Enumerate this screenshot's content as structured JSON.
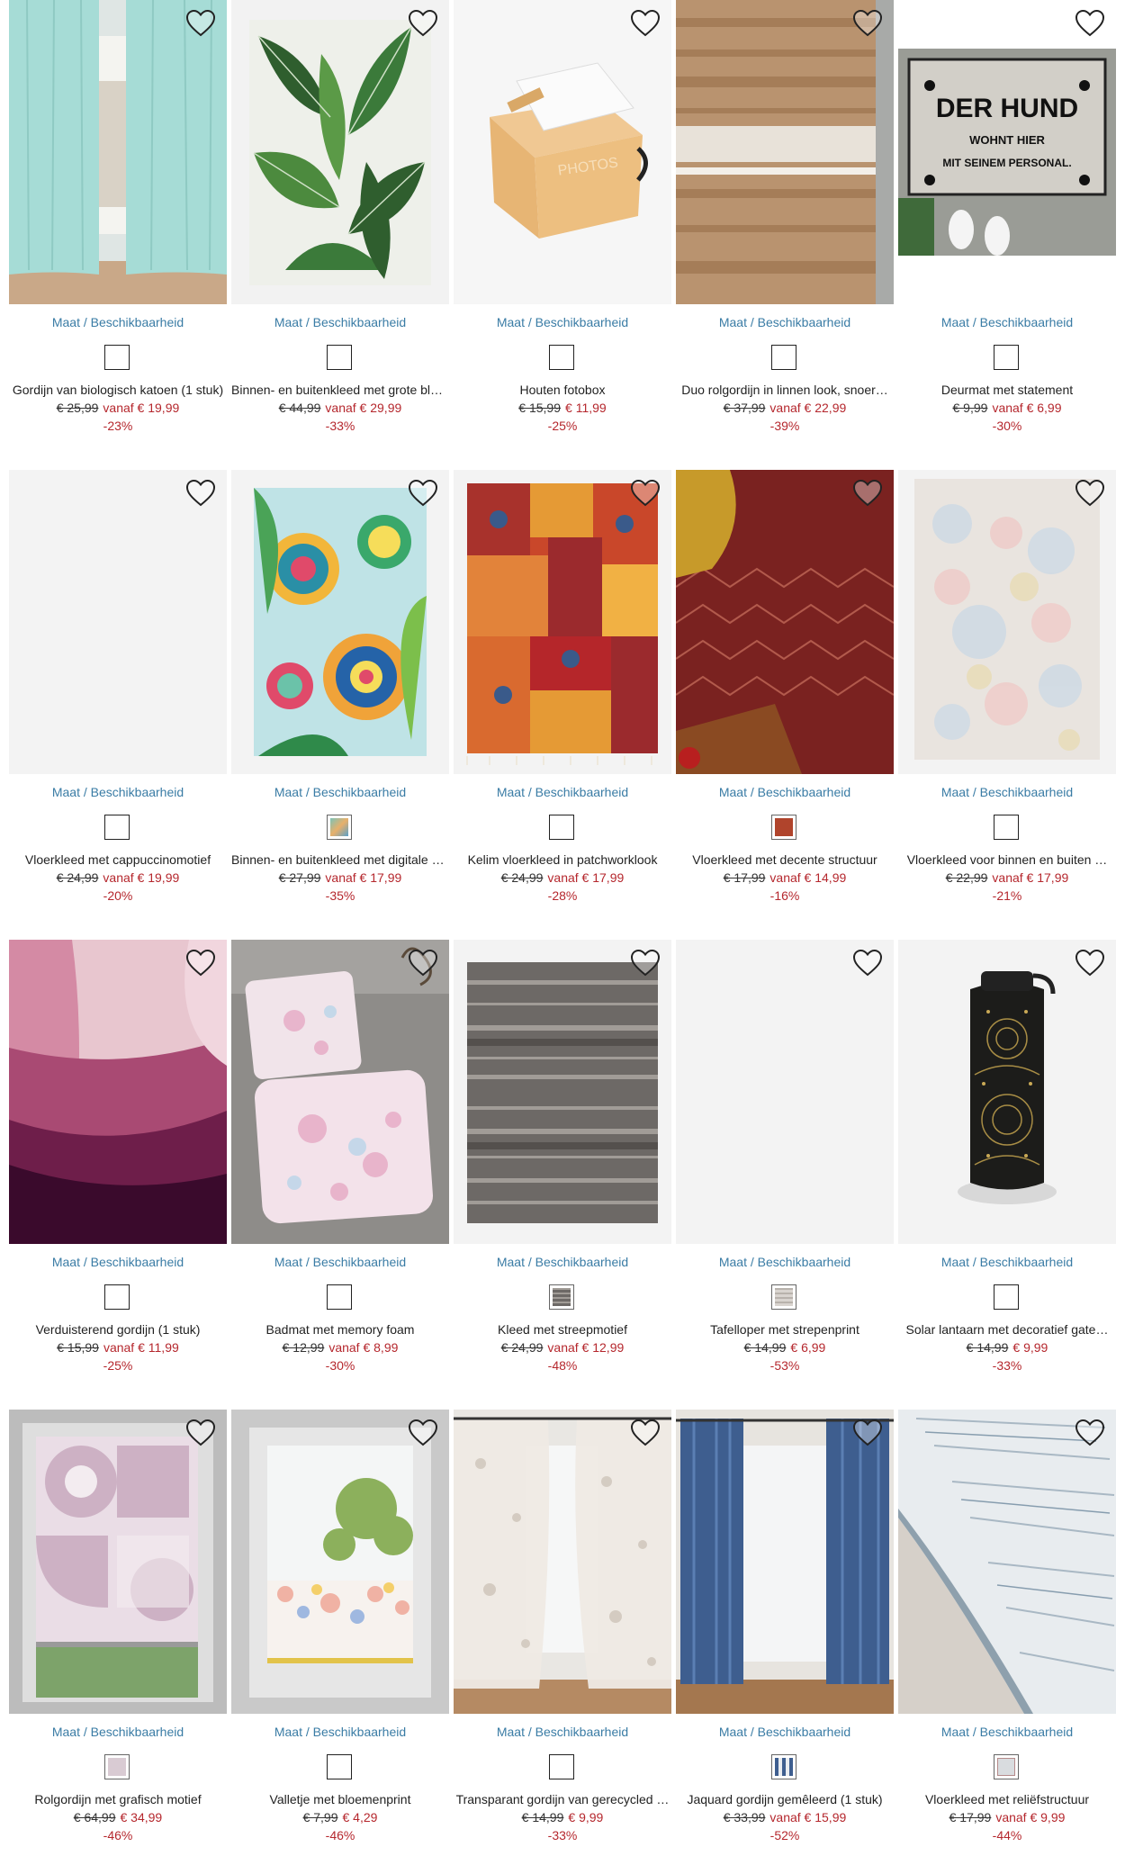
{
  "size_link_label": "Maat / Beschikbaarheid",
  "colors": {
    "link": "#3a7ca5",
    "sale": "#b5272d",
    "text": "#222222"
  },
  "favorite_icon": "heart-outline-icon",
  "products": [
    {
      "name": "Gordijn van biologisch katoen (1 stuk)",
      "old_price": "€ 25,99",
      "new_price": "vanaf € 19,99",
      "discount": "-23%"
    },
    {
      "name": "Binnen- en buitenkleed met grote bladeren",
      "old_price": "€ 44,99",
      "new_price": "vanaf € 29,99",
      "discount": "-33%"
    },
    {
      "name": "Houten fotobox",
      "old_price": "€ 15,99",
      "new_price": "€ 11,99",
      "discount": "-25%",
      "image_text": "PHOTOS"
    },
    {
      "name": "Duo rolgordijn in linnen look, snoer…",
      "old_price": "€ 37,99",
      "new_price": "vanaf € 22,99",
      "discount": "-39%"
    },
    {
      "name": "Deurmat met statement",
      "old_price": "€ 9,99",
      "new_price": "vanaf € 6,99",
      "discount": "-30%",
      "image_text": [
        "DER HUND",
        "WOHNT HIER",
        "MIT SEINEM PERSONAL."
      ]
    },
    {
      "name": "Vloerkleed met cappuccinomotief",
      "old_price": "€ 24,99",
      "new_price": "vanaf € 19,99",
      "discount": "-20%"
    },
    {
      "name": "Binnen- en buitenkleed met digitale print",
      "old_price": "€ 27,99",
      "new_price": "vanaf € 17,99",
      "discount": "-35%"
    },
    {
      "name": "Kelim vloerkleed in patchworklook",
      "old_price": "€ 24,99",
      "new_price": "vanaf € 17,99",
      "discount": "-28%"
    },
    {
      "name": "Vloerkleed met decente structuur",
      "old_price": "€ 17,99",
      "new_price": "vanaf € 14,99",
      "discount": "-16%"
    },
    {
      "name": "Vloerkleed voor binnen en buiten …",
      "old_price": "€ 22,99",
      "new_price": "vanaf € 17,99",
      "discount": "-21%"
    },
    {
      "name": "Verduisterend gordijn (1 stuk)",
      "old_price": "€ 15,99",
      "new_price": "vanaf € 11,99",
      "discount": "-25%"
    },
    {
      "name": "Badmat met memory foam",
      "old_price": "€ 12,99",
      "new_price": "vanaf € 8,99",
      "discount": "-30%"
    },
    {
      "name": "Kleed met streepmotief",
      "old_price": "€ 24,99",
      "new_price": "vanaf € 12,99",
      "discount": "-48%"
    },
    {
      "name": "Tafelloper met strepenprint",
      "old_price": "€ 14,99",
      "new_price": "€ 6,99",
      "discount": "-53%"
    },
    {
      "name": "Solar lantaarn met decoratief gate…",
      "old_price": "€ 14,99",
      "new_price": "€ 9,99",
      "discount": "-33%"
    },
    {
      "name": "Rolgordijn met grafisch motief",
      "old_price": "€ 64,99",
      "new_price": "€ 34,99",
      "discount": "-46%"
    },
    {
      "name": "Valletje met bloemenprint",
      "old_price": "€ 7,99",
      "new_price": "€ 4,29",
      "discount": "-46%"
    },
    {
      "name": "Transparant gordijn van gerecycled …",
      "old_price": "€ 14,99",
      "new_price": "€ 9,99",
      "discount": "-33%"
    },
    {
      "name": "Jaquard gordijn gemêleerd (1 stuk)",
      "old_price": "€ 33,99",
      "new_price": "vanaf € 15,99",
      "discount": "-52%"
    },
    {
      "name": "Vloerkleed met reliëfstructuur",
      "old_price": "€ 17,99",
      "new_price": "vanaf € 9,99",
      "discount": "-44%"
    }
  ]
}
